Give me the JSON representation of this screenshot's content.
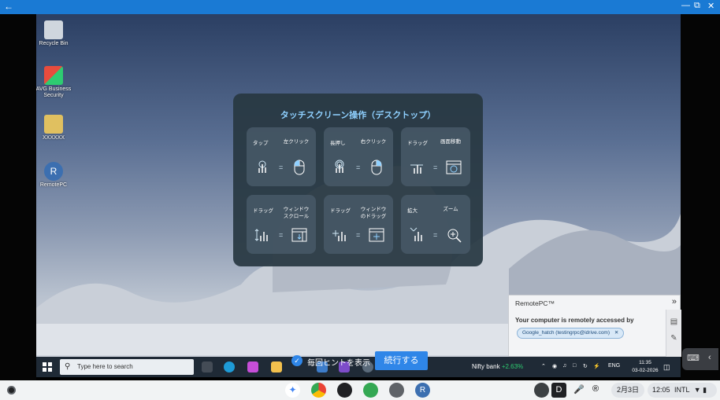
{
  "window": {
    "back_icon": "back-arrow-icon",
    "controls": [
      "minimize-icon",
      "restore-icon",
      "close-icon"
    ]
  },
  "desktop_icons": [
    {
      "label": "Recycle Bin"
    },
    {
      "label": "AVG Business Security"
    },
    {
      "label": "XXXXXX"
    },
    {
      "label": "RemotePC"
    }
  ],
  "hint_panel": {
    "title": "タッチスクリーン操作（デスクトップ）",
    "cards": [
      {
        "left": "タップ",
        "right": "左クリック",
        "gesture_icon": "tap-gesture-icon",
        "result_icon": "mouse-left-click-icon"
      },
      {
        "left": "長押し",
        "right": "右クリック",
        "gesture_icon": "long-press-gesture-icon",
        "result_icon": "mouse-right-click-icon"
      },
      {
        "left": "ドラッグ",
        "right": "画面移動",
        "gesture_icon": "drag-gesture-icon",
        "result_icon": "screen-move-icon"
      },
      {
        "left": "ドラッグ",
        "right": "ウィンドウスクロール",
        "gesture_icon": "vertical-drag-gesture-icon",
        "result_icon": "window-scroll-icon"
      },
      {
        "left": "ドラッグ",
        "right": "ウィンドウのドラッグ",
        "gesture_icon": "multi-drag-gesture-icon",
        "result_icon": "window-drag-icon"
      },
      {
        "left": "拡大",
        "right": "ズーム",
        "gesture_icon": "pinch-gesture-icon",
        "result_icon": "zoom-icon"
      }
    ],
    "equals": "="
  },
  "show_hint": {
    "label": "毎回ヒントを表示",
    "checked": true
  },
  "continue_button": {
    "label": "続行する"
  },
  "windows_taskbar": {
    "search_placeholder": "Type here to search",
    "nifty_label": "Nifty bank",
    "nifty_change": "+2.63%",
    "lang": "ENG",
    "time": "11:35",
    "date": "03-02-2026"
  },
  "remotepc_popup": {
    "title": "RemotePC™",
    "message": "Your computer is remotely accessed by",
    "user_chip": "Google_hatch (testingrpc@idrive.com)",
    "chip_close": "✕"
  },
  "chromeos_shelf": {
    "date": "2月3日",
    "time": "12:05",
    "locale": "INTL"
  },
  "colors": {
    "accent": "#2f86e8",
    "titlebar": "#1a7ad4",
    "hint_title": "#8fd0ff",
    "positive": "#2ecc71"
  }
}
